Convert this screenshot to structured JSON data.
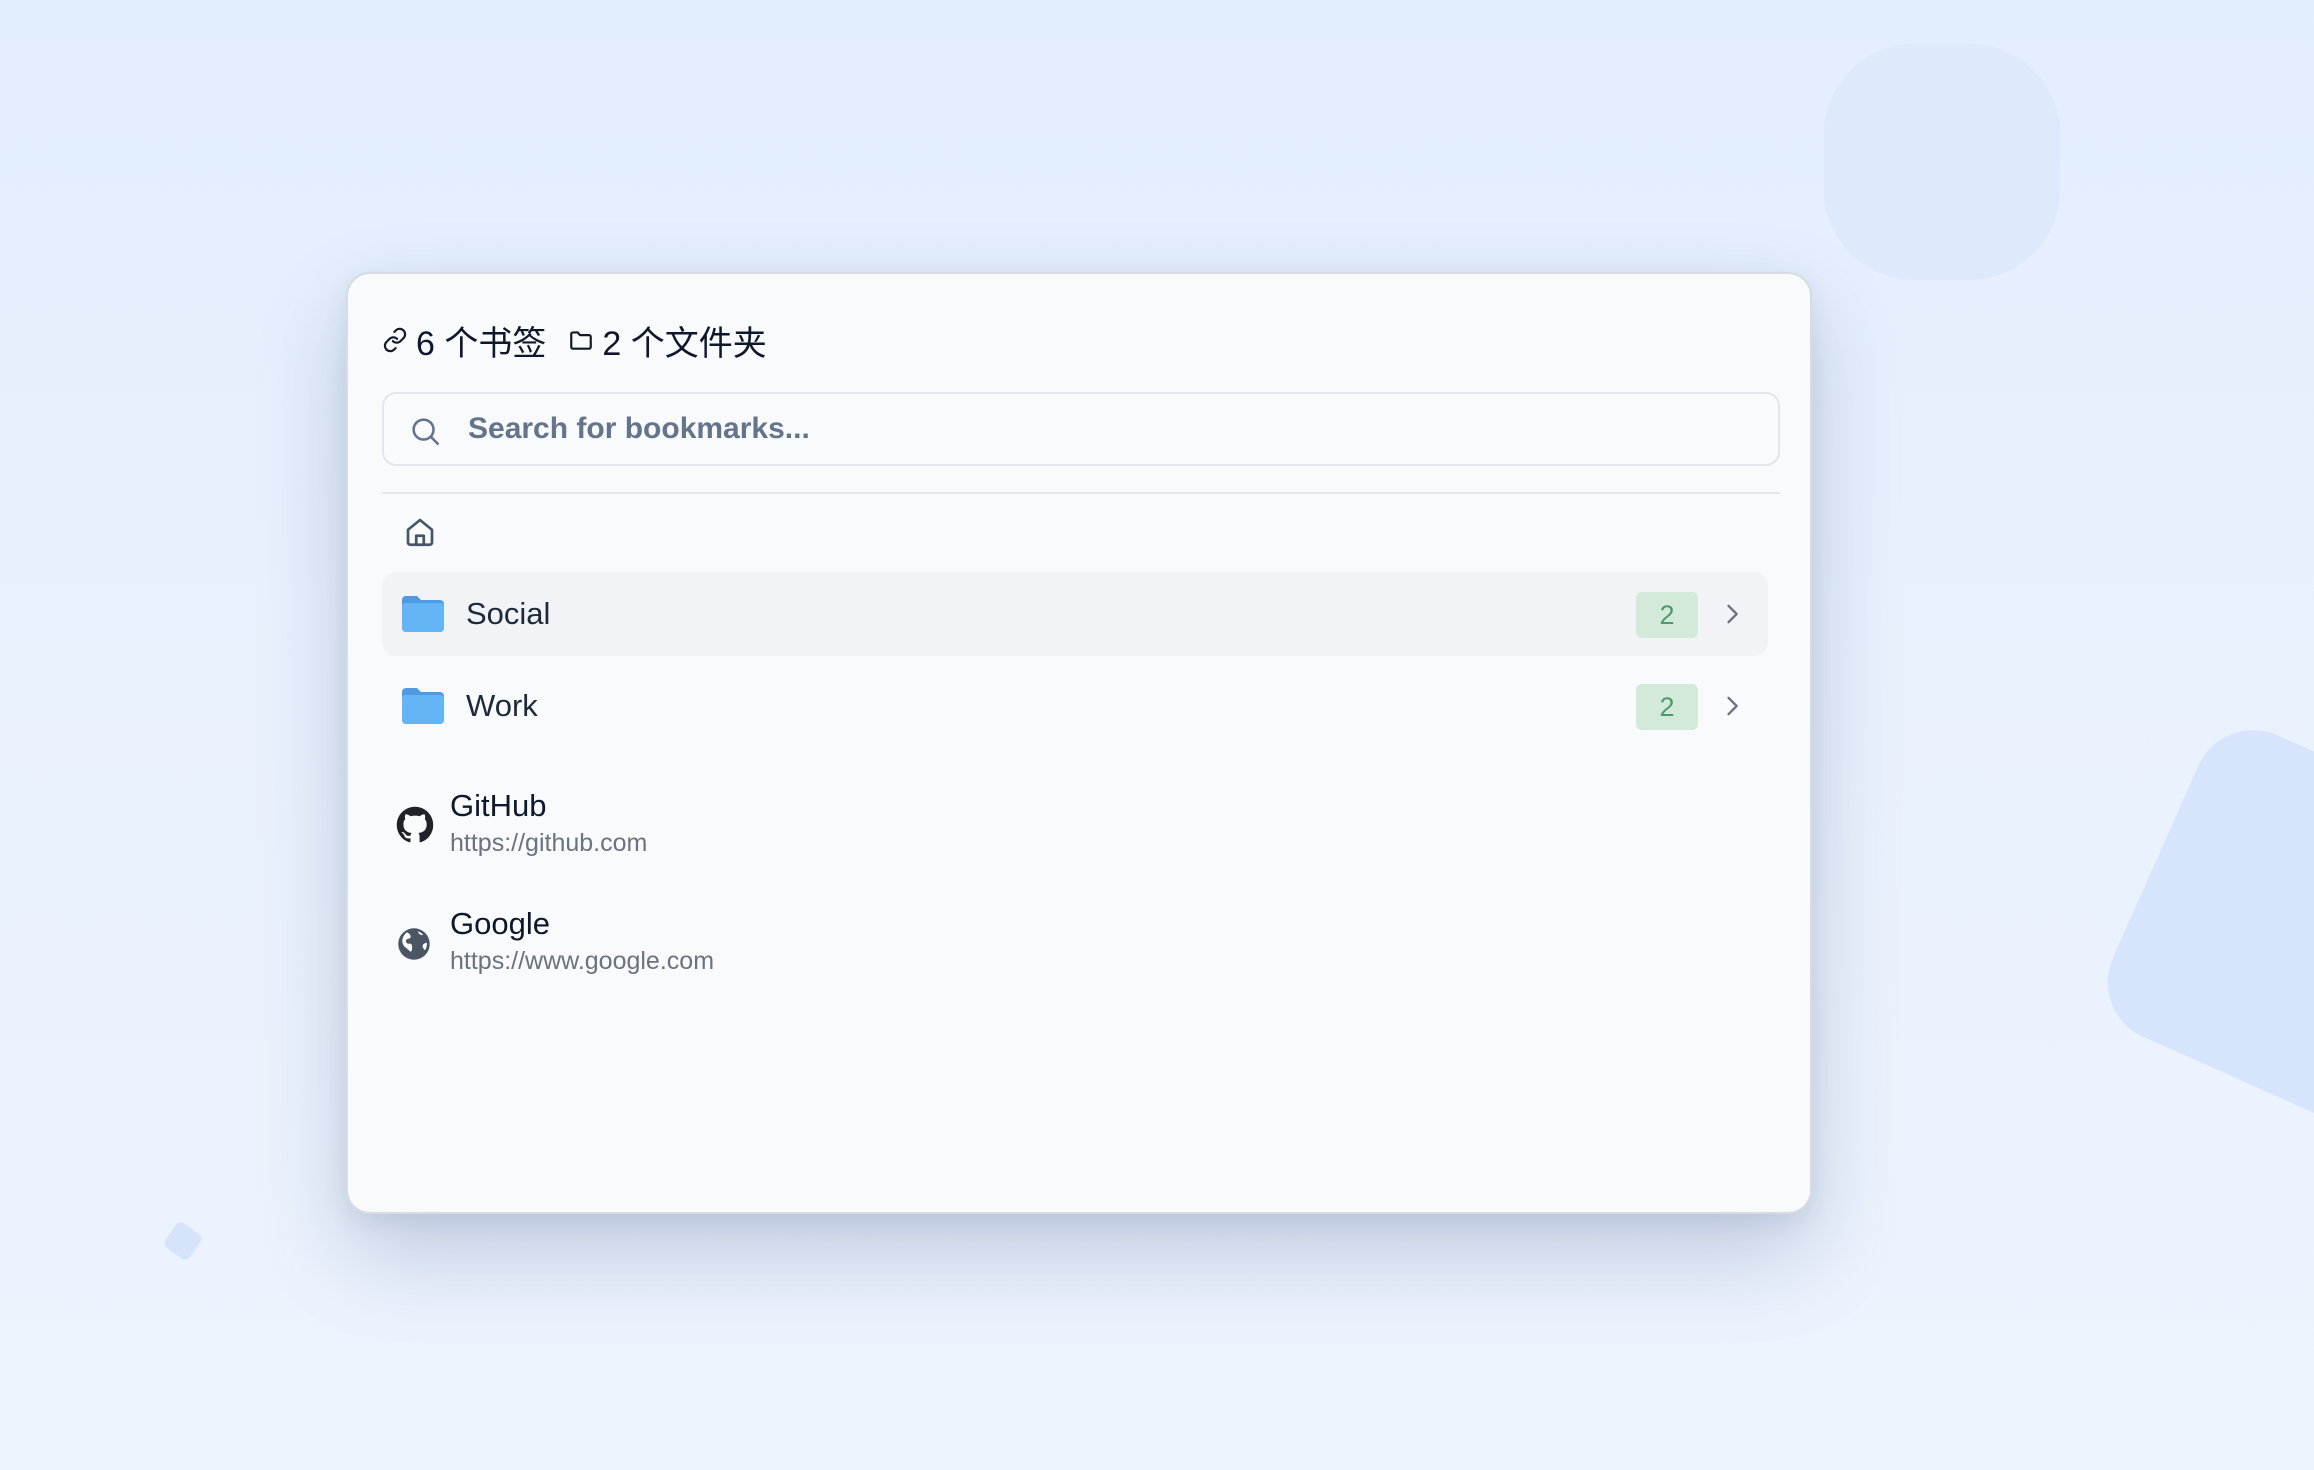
{
  "header": {
    "bookmark_count_label": "6 个书签",
    "folder_count_label": "2 个文件夹",
    "bookmark_icon": "link-icon",
    "folder_icon": "folder-outline-icon"
  },
  "search": {
    "placeholder": "Search for bookmarks...",
    "value": "",
    "icon": "search-icon"
  },
  "breadcrumb": {
    "icon": "home-icon"
  },
  "folders": [
    {
      "name": "Social",
      "count": "2",
      "icon": "folder-icon",
      "highlighted": true
    },
    {
      "name": "Work",
      "count": "2",
      "icon": "folder-icon",
      "highlighted": false
    }
  ],
  "bookmarks": [
    {
      "title": "GitHub",
      "url": "https://github.com",
      "icon": "github-icon"
    },
    {
      "title": "Google",
      "url": "https://www.google.com",
      "icon": "globe-icon"
    }
  ],
  "colors": {
    "badge_bg": "#d3eadb",
    "badge_text": "#4d9b6d",
    "folder_blue": "#5aacf0",
    "row_highlight": "#f1f3f6"
  }
}
